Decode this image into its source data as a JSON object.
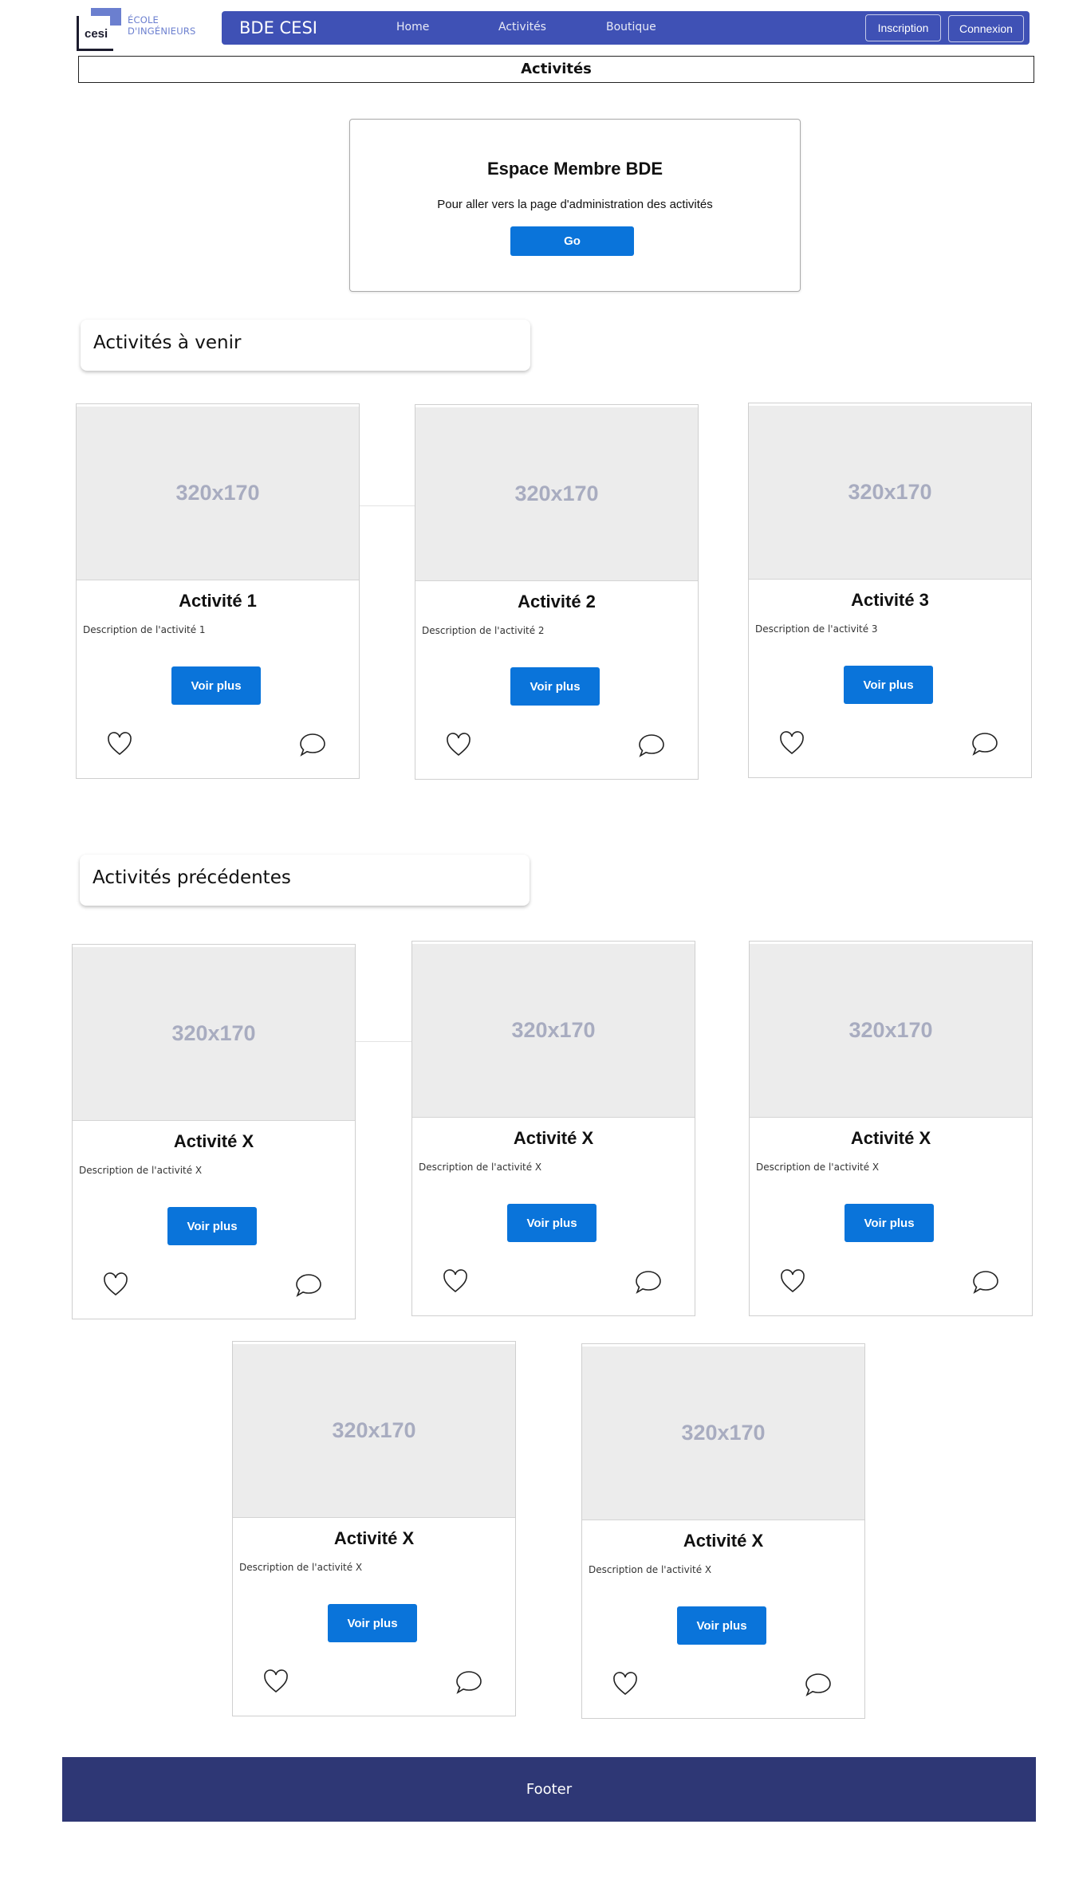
{
  "logo": {
    "mark": "cesi",
    "line1": "ÉCOLE",
    "line2": "D'INGÉNIEURS"
  },
  "navbar": {
    "brand": "BDE CESI",
    "links": [
      "Home",
      "Activités",
      "Boutique"
    ],
    "signup_label": "Inscription",
    "login_label": "Connexion",
    "color": "#3f51b5"
  },
  "page_title": "Activités",
  "member_box": {
    "title": "Espace Membre BDE",
    "description": "Pour aller vers la page d'administration des activités",
    "button_label": "Go"
  },
  "upcoming": {
    "heading": "Activités à venir",
    "cards": [
      {
        "image_label": "320x170",
        "title": "Activité 1",
        "description": "Description de l'activité 1",
        "button_label": "Voir plus"
      },
      {
        "image_label": "320x170",
        "title": "Activité 2",
        "description": "Description de l'activité 2",
        "button_label": "Voir plus"
      },
      {
        "image_label": "320x170",
        "title": "Activité 3",
        "description": "Description de l'activité 3",
        "button_label": "Voir plus"
      }
    ]
  },
  "previous": {
    "heading": "Activités précédentes",
    "cards": [
      {
        "image_label": "320x170",
        "title": "Activité X",
        "description": "Description de l'activité X",
        "button_label": "Voir plus"
      },
      {
        "image_label": "320x170",
        "title": "Activité X",
        "description": "Description de l'activité X",
        "button_label": "Voir plus"
      },
      {
        "image_label": "320x170",
        "title": "Activité X",
        "description": "Description de l'activité X",
        "button_label": "Voir plus"
      },
      {
        "image_label": "320x170",
        "title": "Activité X",
        "description": "Description de l'activité X",
        "button_label": "Voir plus"
      },
      {
        "image_label": "320x170",
        "title": "Activité X",
        "description": "Description de l'activité X",
        "button_label": "Voir plus"
      }
    ]
  },
  "icons": {
    "like": "heart-icon",
    "comment": "comment-icon"
  },
  "accent_color": "#0a74da",
  "footer": {
    "label": "Footer",
    "color": "#2e3775"
  }
}
